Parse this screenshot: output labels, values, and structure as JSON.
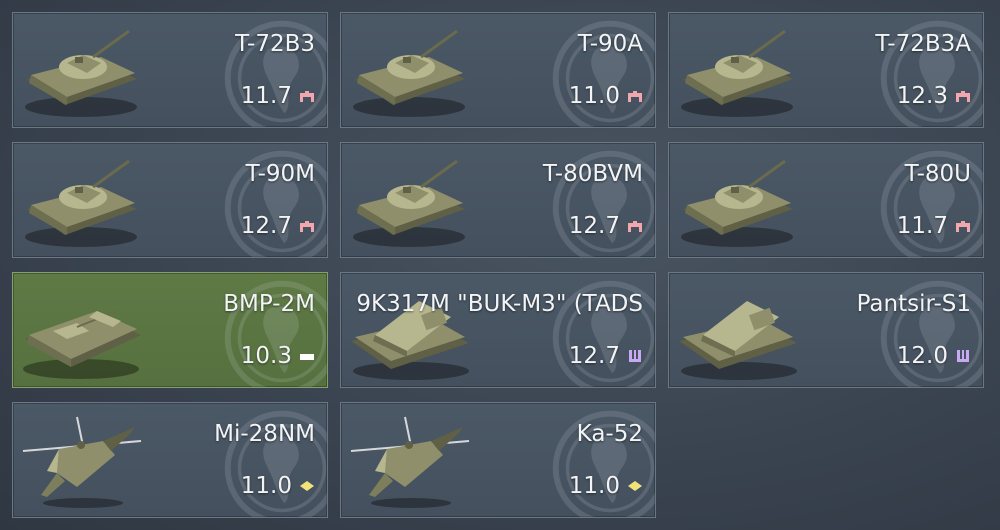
{
  "vehicles": [
    {
      "name": "T-72B3",
      "br": "11.7",
      "kind": "tank",
      "role": "tank-icon",
      "selected": false
    },
    {
      "name": "T-90A",
      "br": "11.0",
      "kind": "tank",
      "role": "tank-icon",
      "selected": false
    },
    {
      "name": "T-72B3A",
      "br": "12.3",
      "kind": "tank",
      "role": "tank-icon",
      "selected": false
    },
    {
      "name": "T-90M",
      "br": "12.7",
      "kind": "tank",
      "role": "tank-icon",
      "selected": false
    },
    {
      "name": "T-80BVM",
      "br": "12.7",
      "kind": "tank",
      "role": "tank-icon",
      "selected": false
    },
    {
      "name": "T-80U",
      "br": "11.7",
      "kind": "tank",
      "role": "tank-icon",
      "selected": false
    },
    {
      "name": "BMP-2M",
      "br": "10.3",
      "kind": "ifv",
      "role": "light-tank-icon",
      "selected": true
    },
    {
      "name": "9K317M \"BUK-M3\" (TADS",
      "br": "12.7",
      "kind": "spaa",
      "role": "spaa-icon",
      "selected": false
    },
    {
      "name": "Pantsir-S1",
      "br": "12.0",
      "kind": "spaa",
      "role": "spaa-icon",
      "selected": false
    },
    {
      "name": "Mi-28NM",
      "br": "11.0",
      "kind": "heli",
      "role": "helicopter-icon",
      "selected": false
    },
    {
      "name": "Ka-52",
      "br": "11.0",
      "kind": "heli",
      "role": "helicopter-icon",
      "selected": false
    }
  ],
  "colors": {
    "tank_role": "#f0a7ae",
    "light_role": "#ffffff",
    "spaa_role": "#c8a9f2",
    "heli_role": "#f1e27a",
    "selected_card": "#5a7442",
    "card": "#48545f"
  }
}
